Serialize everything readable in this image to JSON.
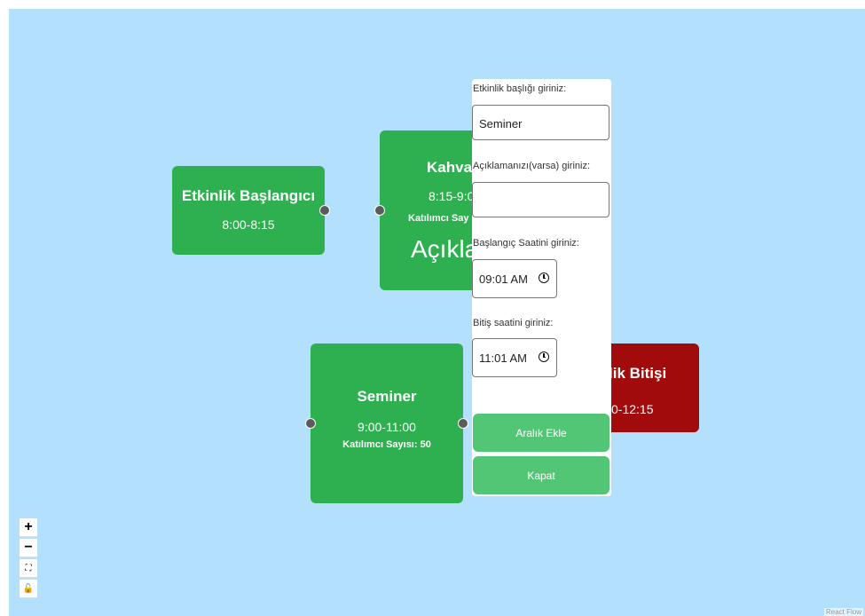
{
  "nodes": {
    "start": {
      "title": "Etkinlik Başlangıcı",
      "time": "8:00-8:15"
    },
    "coffee": {
      "title": "Kahva",
      "time": "8:15-9:0",
      "participants": "Katılımcı Say",
      "description": "Açıkla"
    },
    "seminar": {
      "title": "Seminer",
      "time": "9:00-11:00",
      "participants": "Katılımcı Sayısı: 50"
    },
    "end": {
      "title": "lik Bitişi",
      "time": "0-12:15"
    }
  },
  "form": {
    "title_label": "Etkinlik başlığı giriniz:",
    "title_value": "Seminer",
    "description_label": "Açıklamanızı(varsa) giriniz:",
    "description_value": "",
    "start_label": "Başlangıç Saatini giriniz:",
    "start_value": "09:01 AM",
    "end_label": "Bitiş saatini giriniz:",
    "end_value": "11:01 AM",
    "add_button": "Aralık Ekle",
    "close_button": "Kapat"
  },
  "controls": {
    "zoom_in": "+",
    "zoom_out": "−",
    "fit_view": "⛶",
    "lock": "🔓"
  },
  "attribution": "React Flow",
  "colors": {
    "canvas": "#b3e0fc",
    "node_green": "#2eb050",
    "node_red": "#a10b0b",
    "button": "#53c675"
  }
}
